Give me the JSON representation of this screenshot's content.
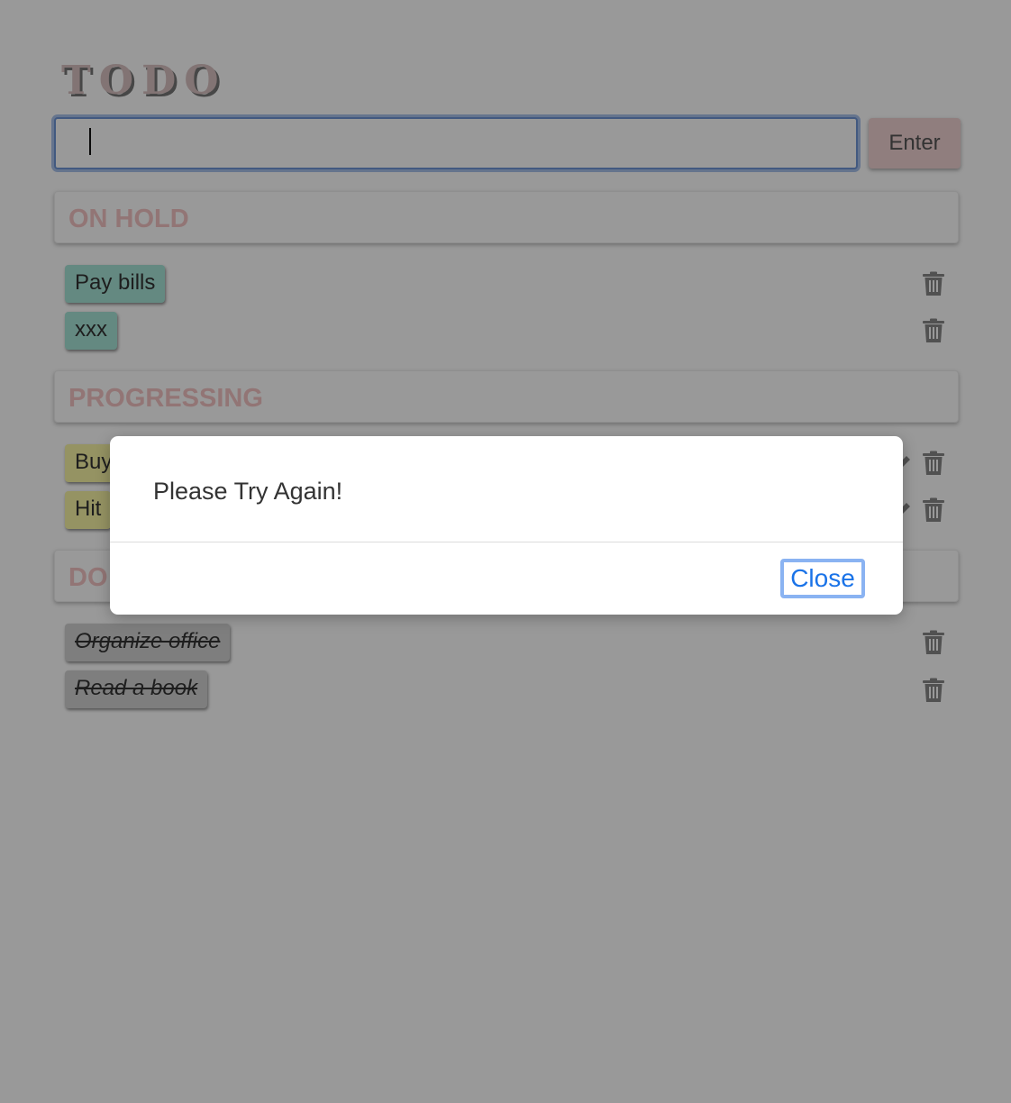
{
  "app": {
    "title": "TODO"
  },
  "input": {
    "value": "",
    "placeholder": ""
  },
  "enter_button": {
    "label": "Enter"
  },
  "sections": [
    {
      "title": "ON HOLD",
      "tasks": [
        {
          "label": "Pay bills"
        },
        {
          "label": "xxx"
        }
      ]
    },
    {
      "title": "PROGRESSING",
      "tasks": [
        {
          "label": "Buy"
        },
        {
          "label": "Hit"
        }
      ]
    },
    {
      "title": "DO",
      "tasks": [
        {
          "label": "Organize office"
        },
        {
          "label": "Read a book"
        }
      ]
    }
  ],
  "icons": {
    "delete": "trash-icon",
    "edit": "pencil-icon"
  },
  "colors": {
    "on_hold_chip": "#a7e5d7",
    "progressing_chip": "#f9f5a6",
    "done_chip": "#d2d2d2",
    "section_title": "#f3c4c4",
    "enter_button": "#f1d3d3",
    "focus_ring": "#6e95d6",
    "close_text": "#1a73e8"
  },
  "modal": {
    "message": "Please Try Again!",
    "close_label": "Close"
  }
}
